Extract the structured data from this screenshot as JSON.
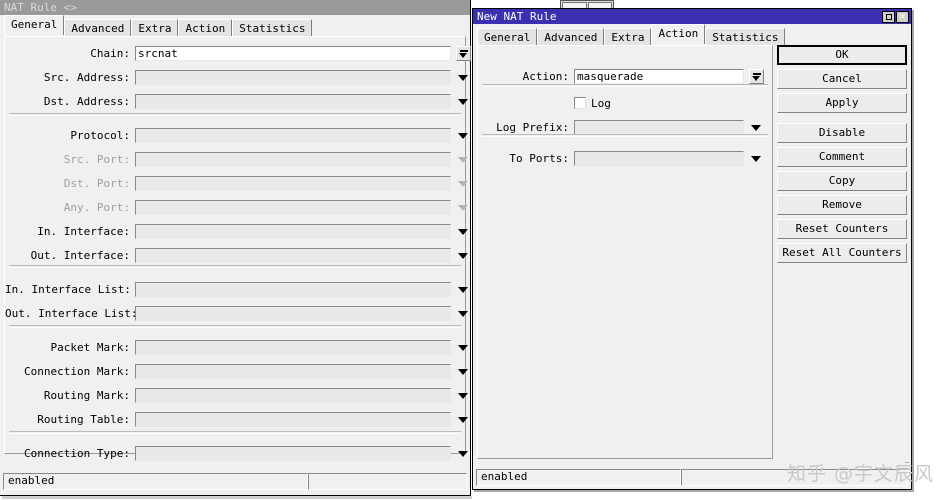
{
  "left_window": {
    "title": "NAT Rule <>",
    "active": false,
    "tabs": [
      {
        "label": "General",
        "active": true
      },
      {
        "label": "Advanced",
        "active": false
      },
      {
        "label": "Extra",
        "active": false
      },
      {
        "label": "Action",
        "active": false
      },
      {
        "label": "Statistics",
        "active": false
      }
    ],
    "fields": [
      {
        "label": "Chain:",
        "value": "srcnat",
        "editable": true,
        "arrow": "boxed",
        "disabled": false
      },
      {
        "label": "Src. Address:",
        "value": "",
        "editable": false,
        "arrow": "plain",
        "disabled": false
      },
      {
        "label": "Dst. Address:",
        "value": "",
        "editable": false,
        "arrow": "plain",
        "disabled": false
      },
      {
        "label": "Protocol:",
        "value": "",
        "editable": false,
        "arrow": "plain",
        "disabled": false
      },
      {
        "label": "Src. Port:",
        "value": "",
        "editable": false,
        "arrow": "dim",
        "disabled": true
      },
      {
        "label": "Dst. Port:",
        "value": "",
        "editable": false,
        "arrow": "dim",
        "disabled": true
      },
      {
        "label": "Any. Port:",
        "value": "",
        "editable": false,
        "arrow": "dim",
        "disabled": true
      },
      {
        "label": "In. Interface:",
        "value": "",
        "editable": false,
        "arrow": "plain",
        "disabled": false
      },
      {
        "label": "Out. Interface:",
        "value": "",
        "editable": false,
        "arrow": "plain",
        "disabled": false
      },
      {
        "label": "In. Interface List:",
        "value": "",
        "editable": false,
        "arrow": "plain",
        "disabled": false
      },
      {
        "label": "Out. Interface List:",
        "value": "",
        "editable": false,
        "arrow": "plain",
        "disabled": false
      },
      {
        "label": "Packet Mark:",
        "value": "",
        "editable": false,
        "arrow": "plain",
        "disabled": false
      },
      {
        "label": "Connection Mark:",
        "value": "",
        "editable": false,
        "arrow": "plain",
        "disabled": false
      },
      {
        "label": "Routing Mark:",
        "value": "",
        "editable": false,
        "arrow": "plain",
        "disabled": false
      },
      {
        "label": "Routing Table:",
        "value": "",
        "editable": false,
        "arrow": "plain",
        "disabled": false
      },
      {
        "label": "Connection Type:",
        "value": "",
        "editable": false,
        "arrow": "plain",
        "disabled": false
      }
    ],
    "status": "enabled",
    "status_right": ""
  },
  "right_window": {
    "title": "New NAT Rule",
    "active": true,
    "window_buttons": [
      {
        "name": "maximize-button",
        "glyph": ""
      },
      {
        "name": "close-button",
        "glyph": "×"
      }
    ],
    "tabs": [
      {
        "label": "General",
        "active": false
      },
      {
        "label": "Advanced",
        "active": false
      },
      {
        "label": "Extra",
        "active": false
      },
      {
        "label": "Action",
        "active": true
      },
      {
        "label": "Statistics",
        "active": false
      }
    ],
    "fields": [
      {
        "label": "Action:",
        "value": "masquerade",
        "editable": true,
        "arrow": "boxed",
        "disabled": false
      },
      {
        "label": "Log Prefix:",
        "value": "",
        "editable": false,
        "arrow": "plain",
        "disabled": false
      },
      {
        "label": "To Ports:",
        "value": "",
        "editable": false,
        "arrow": "plain",
        "disabled": false
      }
    ],
    "checkbox": {
      "label": "Log",
      "checked": false
    },
    "buttons": [
      {
        "label": "OK",
        "default": true
      },
      {
        "label": "Cancel",
        "default": false
      },
      {
        "label": "Apply",
        "default": false
      },
      {
        "label": "Disable",
        "default": false
      },
      {
        "label": "Comment",
        "default": false
      },
      {
        "label": "Copy",
        "default": false
      },
      {
        "label": "Remove",
        "default": false
      },
      {
        "label": "Reset Counters",
        "default": false
      },
      {
        "label": "Reset All Counters",
        "default": false
      }
    ],
    "status": "enabled"
  },
  "watermark": "知乎 @宇文辰风",
  "colors": {
    "active_title": "#3b30b0",
    "inactive_title": "#9a9a9a",
    "window_face": "#f0f0f0",
    "field_disabled": "#e9e9e9",
    "field_editable": "#ffffff"
  }
}
